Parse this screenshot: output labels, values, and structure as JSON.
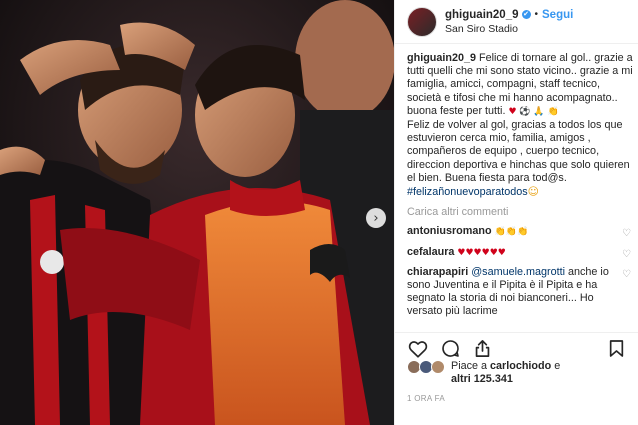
{
  "post": {
    "username": "ghiguain20_9",
    "verified_mark": "✔",
    "separator": "•",
    "follow_label": "Segui",
    "location": "San Siro Stadio",
    "caption_text": "Felice di tornare al gol.. grazie a tutti quelli che mi sono stato vicino.. grazie a mi famiglia, amicci, compagni, staff tecnico, società e tifosi che mi hanno acompagnato.. buona feste per tutti.",
    "caption_emojis": "♥ ⚽ 🙏 👏",
    "caption_text_es": "Feliz de volver al gol, gracias a todos los que estuvieron cerca mio, familia, amigos , compañeros de equipo , cuerpo tecnico, direccion deportiva e hinchas que solo quieren el bien. Buena fiesta para tod@s.",
    "hashtag": "#felizañonuevoparatodos",
    "hashtag_emoji": "☺"
  },
  "comments": {
    "load_more_label": "Carica altri commenti",
    "items": [
      {
        "user": "antoniusromano",
        "text": "👏👏👏"
      },
      {
        "user": "cefalaura",
        "text": "♥♥♥♥♥♥"
      },
      {
        "user": "chiarapapiri",
        "mention": "@samuele.magrotti",
        "text": "anche io sono Juventina e il Pipita è il Pipita e ha segnato la storia di noi bianconeri... Ho versato più lacrime"
      }
    ]
  },
  "likes": {
    "prefix": "Piace a",
    "user": "carlochiodo",
    "middle": "e",
    "others": "altri 125.341"
  },
  "timestamp": "1 ORA FA",
  "icons": {
    "heart": "heart-icon",
    "comment": "comment-icon",
    "share": "share-icon",
    "bookmark": "bookmark-icon",
    "carousel": "chevron-right-icon"
  },
  "colors": {
    "link_blue": "#3897f0",
    "hashtag": "#003569",
    "muted": "#999999",
    "milan_red": "#b3121a"
  },
  "carousel_arrow": "›"
}
